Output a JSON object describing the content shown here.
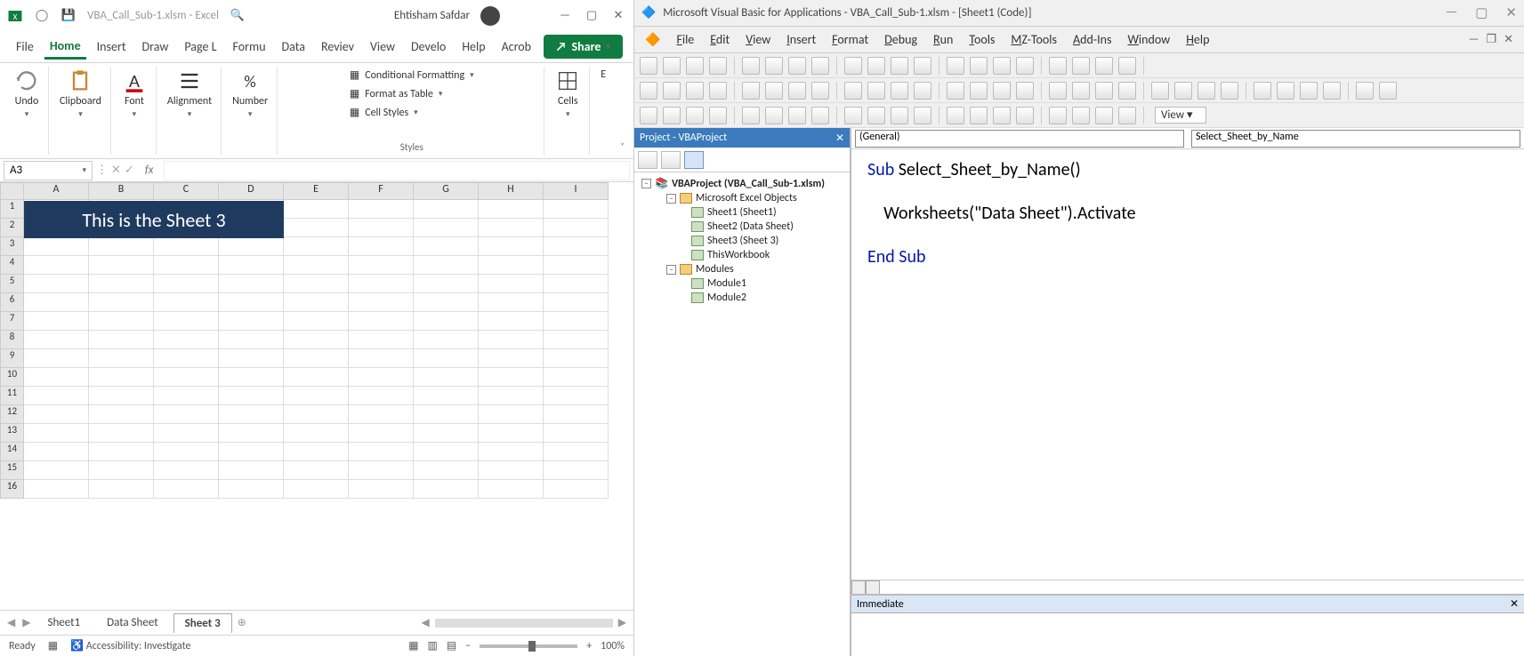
{
  "excel": {
    "title_file": "VBA_Call_Sub-1.xlsm - Excel",
    "user_name": "Ehtisham Safdar",
    "ribbon_tabs": [
      "File",
      "Home",
      "Insert",
      "Draw",
      "Page L",
      "Formu",
      "Data",
      "Reviev",
      "View",
      "Develo",
      "Help",
      "Acrob"
    ],
    "active_tab_index": 1,
    "share_label": "Share",
    "groups": {
      "undo": "Undo",
      "clipboard": "Clipboard",
      "font": "Font",
      "alignment": "Alignment",
      "number": "Number",
      "cells": "Cells",
      "editing": "E",
      "styles": "Styles",
      "cond_fmt": "Conditional Formatting",
      "fmt_table": "Format as Table",
      "cell_styles": "Cell Styles"
    },
    "name_box": "A3",
    "banner": "This is the Sheet 3",
    "columns": [
      "A",
      "B",
      "C",
      "D",
      "E",
      "F",
      "G",
      "H",
      "I"
    ],
    "rows": [
      "1",
      "2",
      "3",
      "4",
      "5",
      "6",
      "7",
      "8",
      "9",
      "10",
      "11",
      "12",
      "13",
      "14",
      "15",
      "16"
    ],
    "sheets": [
      "Sheet1",
      "Data Sheet",
      "Sheet 3"
    ],
    "active_sheet_index": 2,
    "status_ready": "Ready",
    "status_access": "Accessibility: Investigate",
    "zoom": "100%"
  },
  "vba": {
    "title": "Microsoft Visual Basic for Applications - VBA_Call_Sub-1.xlsm - [Sheet1 (Code)]",
    "menus": [
      "File",
      "Edit",
      "View",
      "Insert",
      "Format",
      "Debug",
      "Run",
      "Tools",
      "MZ-Tools",
      "Add-Ins",
      "Window",
      "Help"
    ],
    "view_label": "View",
    "project_hdr": "Project - VBAProject",
    "tree": {
      "root": "VBAProject (VBA_Call_Sub-1.xlsm)",
      "excel_objects": "Microsoft Excel Objects",
      "sheet1": "Sheet1 (Sheet1)",
      "sheet2": "Sheet2 (Data Sheet)",
      "sheet3": "Sheet3 (Sheet 3)",
      "workbook": "ThisWorkbook",
      "modules": "Modules",
      "mod1": "Module1",
      "mod2": "Module2"
    },
    "combo_left": "(General)",
    "combo_right": "Select_Sheet_by_Name",
    "code": {
      "l1_kw": "Sub",
      "l1_rest": " Select_Sheet_by_Name()",
      "l2": "    Worksheets(\"Data Sheet\").Activate",
      "l3_kw": "End Sub"
    },
    "immediate": "Immediate"
  }
}
